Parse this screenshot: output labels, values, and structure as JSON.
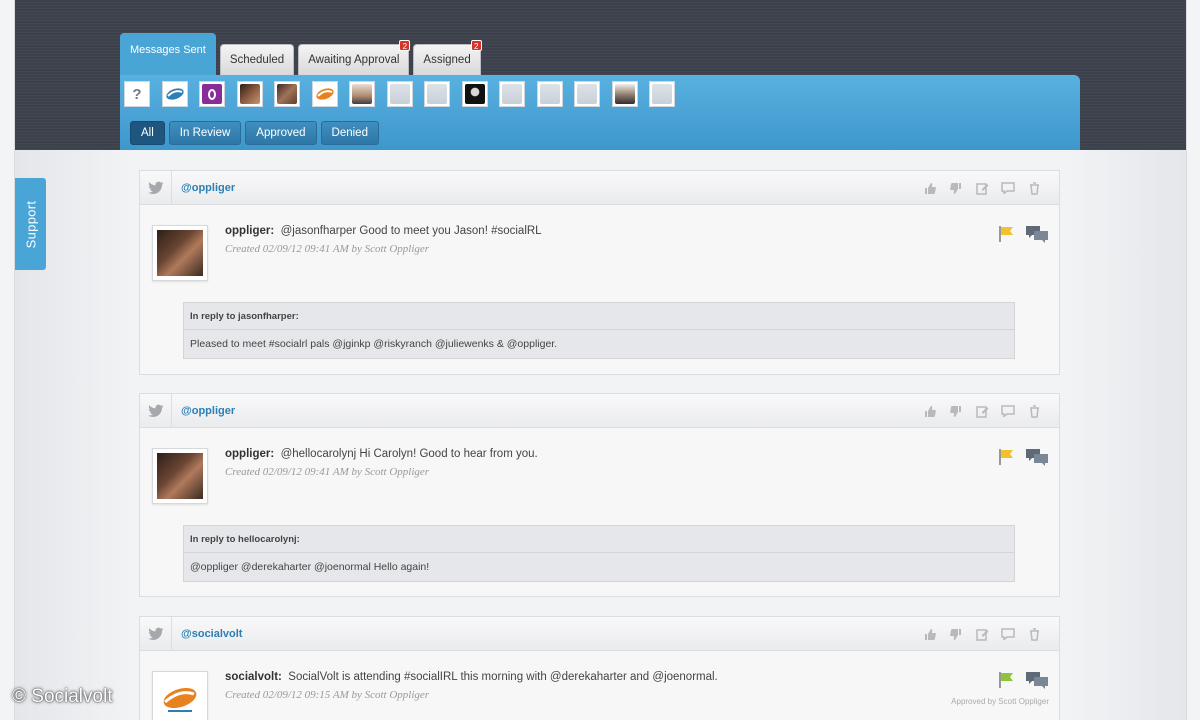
{
  "tabs": [
    {
      "label": "Messages Sent",
      "active": true,
      "badge": ""
    },
    {
      "label": "Scheduled",
      "active": false,
      "badge": ""
    },
    {
      "label": "Awaiting Approval",
      "active": false,
      "badge": "2"
    },
    {
      "label": "Assigned",
      "active": false,
      "badge": "2"
    }
  ],
  "avatar_filters": [
    "question-icon",
    "socialvolt-logo",
    "purple-logo",
    "user-photo",
    "user-photo",
    "orange-logo",
    "user-photo",
    "blank-avatar",
    "blank-avatar",
    "user-photo",
    "blank-avatar",
    "blank-avatar",
    "blank-avatar",
    "user-photo",
    "blank-avatar"
  ],
  "avatar_question_glyph": "?",
  "filters": [
    "All",
    "In Review",
    "Approved",
    "Denied"
  ],
  "support_label": "Support",
  "messages": [
    {
      "handle": "@oppliger",
      "author": "oppliger:",
      "text": "@jasonfharper Good to meet you Jason! #socialRL",
      "meta": "Created 02/09/12 09:41 AM by Scott Oppliger",
      "flag_color": "#f2c12e",
      "reply_to": "In reply to jasonfharper:",
      "reply_text": "Pleased to meet #socialrl pals @jginkp @riskyranch @juliewenks & @oppliger.",
      "approved_note": ""
    },
    {
      "handle": "@oppliger",
      "author": "oppliger:",
      "text": "@hellocarolynj Hi Carolyn! Good to hear from you.",
      "meta": "Created 02/09/12 09:41 AM by Scott Oppliger",
      "flag_color": "#f2c12e",
      "reply_to": "In reply to hellocarolynj:",
      "reply_text": "@oppliger @derekaharter @joenormal Hello again!",
      "approved_note": ""
    },
    {
      "handle": "@socialvolt",
      "author": "socialvolt:",
      "text": "SocialVolt is attending #socialIRL this morning with @derekaharter and @joenormal.",
      "meta": "Created 02/09/12 09:15 AM by Scott Oppliger",
      "flag_color": "#8fc43a",
      "reply_to": "",
      "reply_text": "",
      "approved_note": "Approved by Scott Oppliger"
    }
  ],
  "copyright": "© Socialvolt",
  "colors": {
    "accent": "#4aa5d7",
    "header": "#3d414c",
    "link": "#2b7fb5"
  }
}
